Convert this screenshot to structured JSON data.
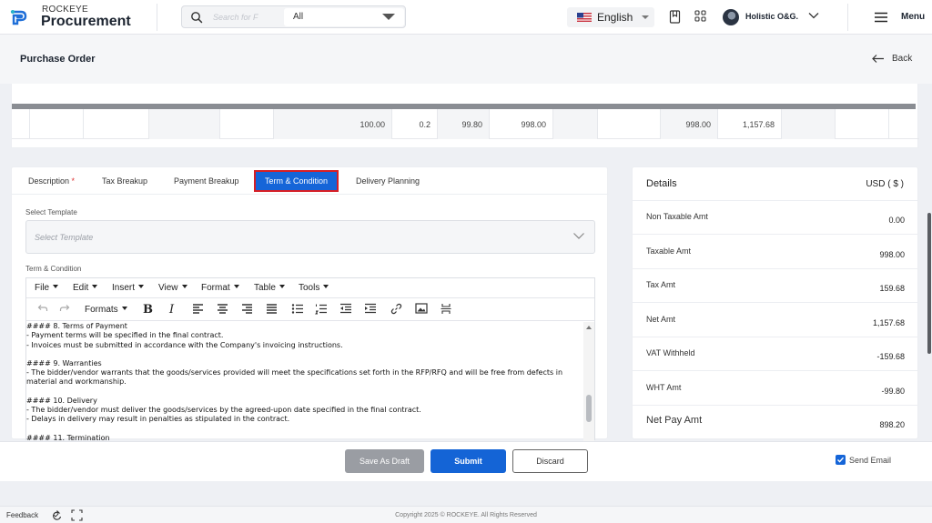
{
  "app": {
    "brand_sub": "ROCKEYE",
    "brand_main": "Procurement"
  },
  "search": {
    "placeholder": "Search for F",
    "scope": "All"
  },
  "header": {
    "language": "English",
    "user": "Holistic O&G.",
    "menu_label": "Menu"
  },
  "page": {
    "title": "Purchase Order",
    "back_label": "Back"
  },
  "items_row": [
    "",
    "",
    "",
    "",
    "",
    "100.00",
    "0.2",
    "99.80",
    "998.00",
    "",
    "",
    "998.00",
    "1,157.68",
    "",
    "",
    ""
  ],
  "tabs": [
    {
      "label": "Description",
      "required": "*"
    },
    {
      "label": "Tax Breakup"
    },
    {
      "label": "Payment Breakup"
    },
    {
      "label": "Term & Condition"
    },
    {
      "label": "Delivery Planning"
    }
  ],
  "form": {
    "template_label": "Select Template",
    "template_placeholder": "Select Template",
    "tc_label": "Term & Condition"
  },
  "editor": {
    "menus": [
      "File",
      "Edit",
      "Insert",
      "View",
      "Format",
      "Table",
      "Tools"
    ],
    "formats_label": "Formats",
    "bold": "B",
    "italic": "I",
    "paragraphs": [
      [
        "#### 8. Terms of Payment",
        "- Payment terms will be specified in the final contract.",
        "- Invoices must be submitted in accordance with the Company's invoicing instructions."
      ],
      [
        "#### 9. Warranties",
        "- The bidder/vendor warrants that the goods/services provided will meet the specifications set forth in the RFP/RFQ and will be free from defects in",
        "material and workmanship."
      ],
      [
        "#### 10. Delivery",
        "- The bidder/vendor must deliver the goods/services by the agreed-upon date specified in the final contract.",
        "- Delays in delivery may result in penalties as stipulated in the contract."
      ],
      [
        "#### 11. Termination"
      ]
    ]
  },
  "details": {
    "title": "Details",
    "currency": "USD ( $ )",
    "rows": [
      {
        "label": "Non Taxable Amt",
        "value": "0.00"
      },
      {
        "label": "Taxable Amt",
        "value": "998.00"
      },
      {
        "label": "Tax Amt",
        "value": "159.68"
      },
      {
        "label": "Net Amt",
        "value": "1,157.68"
      },
      {
        "label": "VAT Withheld",
        "value": "-159.68"
      },
      {
        "label": "WHT Amt",
        "value": "-99.80"
      },
      {
        "label": "Net Pay Amt",
        "value": "898.20"
      }
    ]
  },
  "actions": {
    "save_draft": "Save As Draft",
    "submit": "Submit",
    "discard": "Discard",
    "send_email": "Send Email",
    "send_email_checked": true
  },
  "footer": {
    "feedback": "Feedback",
    "copyright": "Copyright 2025 © ROCKEYE. All Rights Reserved"
  },
  "colors": {
    "primary": "#1565d8",
    "active_tab_outline": "#d61f26",
    "draft_button": "#9a9da3"
  }
}
